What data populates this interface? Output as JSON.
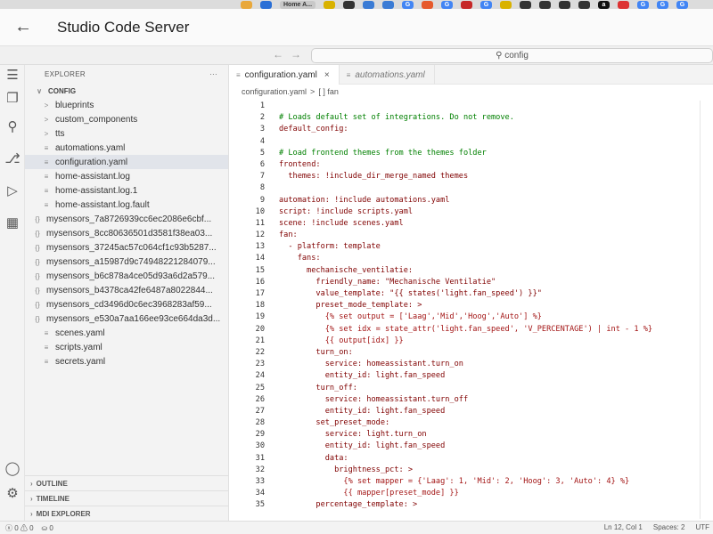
{
  "browser": {
    "bookmark_labels": [
      "Home A...",
      "G",
      "G",
      "G",
      "a",
      "G",
      "G",
      "G"
    ]
  },
  "header": {
    "title": "Studio Code Server"
  },
  "command_center": {
    "search_text": "config"
  },
  "sidebar": {
    "title": "EXPLORER",
    "more": "···",
    "folder": "CONFIG",
    "items": [
      {
        "label": "blueprints",
        "icon": ">"
      },
      {
        "label": "custom_components",
        "icon": ">"
      },
      {
        "label": "tts",
        "icon": ">"
      },
      {
        "label": "automations.yaml",
        "icon": "≡"
      },
      {
        "label": "configuration.yaml",
        "icon": "≡"
      },
      {
        "label": "home-assistant.log",
        "icon": "≡"
      },
      {
        "label": "home-assistant.log.1",
        "icon": "≡"
      },
      {
        "label": "home-assistant.log.fault",
        "icon": "≡"
      },
      {
        "label": "mysensors_7a8726939cc6ec2086e6cbf...",
        "icon": "{}"
      },
      {
        "label": "mysensors_8cc80636501d3581f38ea03...",
        "icon": "{}"
      },
      {
        "label": "mysensors_37245ac57c064cf1c93b5287...",
        "icon": "{}"
      },
      {
        "label": "mysensors_a15987d9c74948221284079...",
        "icon": "{}"
      },
      {
        "label": "mysensors_b6c878a4ce05d93a6d2a579...",
        "icon": "{}"
      },
      {
        "label": "mysensors_b4378ca42fe6487a8022844...",
        "icon": "{}"
      },
      {
        "label": "mysensors_cd3496d0c6ec3968283af59...",
        "icon": "{}"
      },
      {
        "label": "mysensors_e530a7aa166ee93ce664da3d...",
        "icon": "{}"
      },
      {
        "label": "scenes.yaml",
        "icon": "≡"
      },
      {
        "label": "scripts.yaml",
        "icon": "≡"
      },
      {
        "label": "secrets.yaml",
        "icon": "≡"
      }
    ],
    "sections": [
      "OUTLINE",
      "TIMELINE",
      "MDI EXPLORER"
    ]
  },
  "editor": {
    "tabs": [
      {
        "label": "configuration.yaml",
        "close": "×"
      },
      {
        "label": "automations.yaml"
      }
    ],
    "breadcrumb": [
      "configuration.yaml",
      ">",
      "[ ] fan"
    ],
    "lines": [
      {
        "n": "1",
        "t": ""
      },
      {
        "n": "2",
        "t": "# Loads default set of integrations. Do not remove."
      },
      {
        "n": "3",
        "t": "default_config:"
      },
      {
        "n": "4",
        "t": ""
      },
      {
        "n": "5",
        "t": "# Load frontend themes from the themes folder"
      },
      {
        "n": "6",
        "t": "frontend:"
      },
      {
        "n": "7",
        "t": "  themes: !include_dir_merge_named themes"
      },
      {
        "n": "8",
        "t": ""
      },
      {
        "n": "9",
        "t": "automation: !include automations.yaml"
      },
      {
        "n": "10",
        "t": "script: !include scripts.yaml"
      },
      {
        "n": "11",
        "t": "scene: !include scenes.yaml"
      },
      {
        "n": "12",
        "t": "fan:"
      },
      {
        "n": "13",
        "t": "  - platform: template"
      },
      {
        "n": "14",
        "t": "    fans:"
      },
      {
        "n": "15",
        "t": "      mechanische_ventilatie:"
      },
      {
        "n": "16",
        "t": "        friendly_name: \"Mechanische Ventilatie\""
      },
      {
        "n": "17",
        "t": "        value_template: \"{{ states('light.fan_speed') }}\""
      },
      {
        "n": "18",
        "t": "        preset_mode_template: >"
      },
      {
        "n": "19",
        "t": "          {% set output = ['Laag','Mid','Hoog','Auto'] %}"
      },
      {
        "n": "20",
        "t": "          {% set idx = state_attr('light.fan_speed', 'V_PERCENTAGE') | int - 1 %}"
      },
      {
        "n": "21",
        "t": "          {{ output[idx] }}"
      },
      {
        "n": "22",
        "t": "        turn_on:"
      },
      {
        "n": "23",
        "t": "          service: homeassistant.turn_on"
      },
      {
        "n": "24",
        "t": "          entity_id: light.fan_speed"
      },
      {
        "n": "25",
        "t": "        turn_off:"
      },
      {
        "n": "26",
        "t": "          service: homeassistant.turn_off"
      },
      {
        "n": "27",
        "t": "          entity_id: light.fan_speed"
      },
      {
        "n": "28",
        "t": "        set_preset_mode:"
      },
      {
        "n": "29",
        "t": "          service: light.turn_on"
      },
      {
        "n": "30",
        "t": "          entity_id: light.fan_speed"
      },
      {
        "n": "31",
        "t": "          data:"
      },
      {
        "n": "32",
        "t": "            brightness_pct: >"
      },
      {
        "n": "33",
        "t": "              {% set mapper = {'Laag': 1, 'Mid': 2, 'Hoog': 3, 'Auto': 4} %}"
      },
      {
        "n": "34",
        "t": "              {{ mapper[preset_mode] }}"
      },
      {
        "n": "35",
        "t": "        percentage_template: >"
      }
    ]
  },
  "status_bar": {
    "problems": "ⓧ 0 ⚠ 0",
    "ports": "⛀ 0",
    "position": "Ln 12, Col 1",
    "spaces": "Spaces: 2",
    "encoding": "UTF"
  },
  "colors": {
    "syntax_key": "#800000",
    "syntax_string": "#a31515",
    "syntax_tag": "#0000ff",
    "syntax_comment": "#008000"
  }
}
